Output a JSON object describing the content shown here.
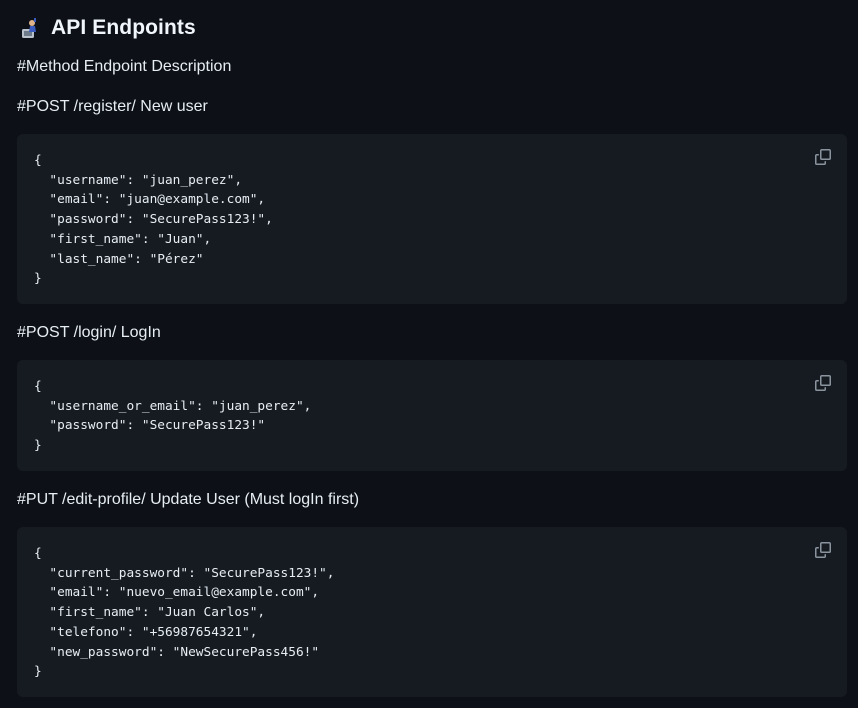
{
  "heading": {
    "icon": "computer-user-emoji-icon",
    "title": "API Endpoints"
  },
  "table_header": "#Method Endpoint Description",
  "sections": [
    {
      "label": "#POST /register/ New user",
      "code_lines": [
        "{",
        "  \"username\": \"juan_perez\",",
        "  \"email\": \"juan@example.com\",",
        "  \"password\": \"SecurePass123!\",",
        "  \"first_name\": \"Juan\",",
        "  \"last_name\": \"Pérez\"",
        "}"
      ],
      "copy_icon": "copy-icon"
    },
    {
      "label": "#POST /login/ LogIn",
      "code_lines": [
        "{",
        "  \"username_or_email\": \"juan_perez\",",
        "  \"password\": \"SecurePass123!\"",
        "}"
      ],
      "copy_icon": "copy-icon"
    },
    {
      "label": "#PUT /edit-profile/ Update User (Must logIn first)",
      "code_lines": [
        "{",
        "  \"current_password\": \"SecurePass123!\",",
        "  \"email\": \"nuevo_email@example.com\",",
        "  \"first_name\": \"Juan Carlos\",",
        "  \"telefono\": \"+56987654321\",",
        "  \"new_password\": \"NewSecurePass456!\"",
        "}"
      ],
      "copy_icon": "copy-icon"
    }
  ],
  "colors": {
    "background": "#0d1117",
    "code_background": "#161b22",
    "text": "#e6edf3",
    "icon": "#8b949e"
  }
}
